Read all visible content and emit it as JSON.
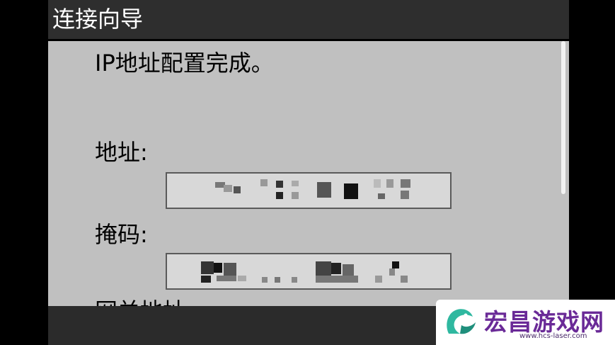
{
  "window": {
    "title": "连接向导"
  },
  "main": {
    "message": "IP地址配置完成。",
    "address_label": "地址:",
    "mask_label": "掩码:",
    "gateway_label_partial": "网关地址"
  },
  "watermark": {
    "text": "宏昌游戏网",
    "url": "www.hcs-laser.com"
  },
  "colors": {
    "titlebar": "#2e2e2e",
    "content": "#c0c0c0",
    "field": "#d8d8d8",
    "watermark_text": "#6a2a97",
    "watermark_logo": "#2fb8a0"
  }
}
